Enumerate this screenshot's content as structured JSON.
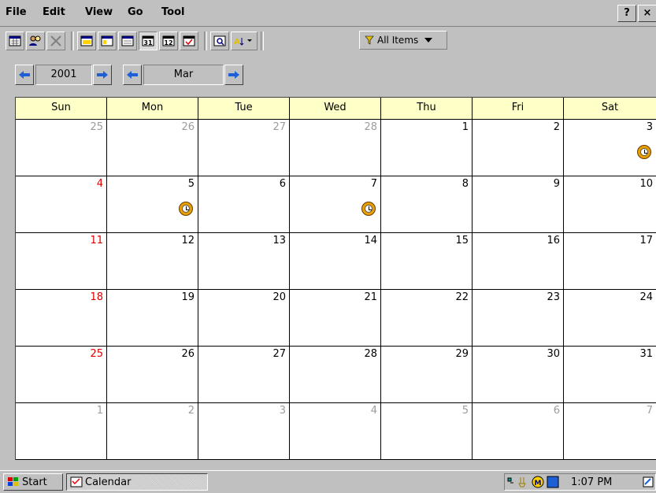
{
  "menu": [
    "File",
    "Edit",
    "View",
    "Go",
    "Tool"
  ],
  "window_buttons": {
    "help": "?",
    "close": "×"
  },
  "toolbar": {
    "filter_label": "All Items"
  },
  "nav": {
    "year": "2001",
    "month": "Mar"
  },
  "days": [
    "Sun",
    "Mon",
    "Tue",
    "Wed",
    "Thu",
    "Fri",
    "Sat"
  ],
  "weeks": [
    [
      {
        "n": "25",
        "t": "other"
      },
      {
        "n": "26",
        "t": "other"
      },
      {
        "n": "27",
        "t": "other"
      },
      {
        "n": "28",
        "t": "other"
      },
      {
        "n": "1",
        "t": "cur"
      },
      {
        "n": "2",
        "t": "cur"
      },
      {
        "n": "3",
        "t": "cur",
        "appt": true
      }
    ],
    [
      {
        "n": "4",
        "t": "sun"
      },
      {
        "n": "5",
        "t": "cur",
        "appt": true
      },
      {
        "n": "6",
        "t": "cur"
      },
      {
        "n": "7",
        "t": "cur",
        "appt": true
      },
      {
        "n": "8",
        "t": "cur"
      },
      {
        "n": "9",
        "t": "cur"
      },
      {
        "n": "10",
        "t": "cur"
      }
    ],
    [
      {
        "n": "11",
        "t": "sun"
      },
      {
        "n": "12",
        "t": "cur"
      },
      {
        "n": "13",
        "t": "cur"
      },
      {
        "n": "14",
        "t": "cur"
      },
      {
        "n": "15",
        "t": "cur"
      },
      {
        "n": "16",
        "t": "cur"
      },
      {
        "n": "17",
        "t": "cur"
      }
    ],
    [
      {
        "n": "18",
        "t": "sun"
      },
      {
        "n": "19",
        "t": "cur"
      },
      {
        "n": "20",
        "t": "cur"
      },
      {
        "n": "21",
        "t": "cur"
      },
      {
        "n": "22",
        "t": "cur"
      },
      {
        "n": "23",
        "t": "cur"
      },
      {
        "n": "24",
        "t": "cur"
      }
    ],
    [
      {
        "n": "25",
        "t": "sun"
      },
      {
        "n": "26",
        "t": "cur"
      },
      {
        "n": "27",
        "t": "cur"
      },
      {
        "n": "28",
        "t": "cur"
      },
      {
        "n": "29",
        "t": "cur"
      },
      {
        "n": "30",
        "t": "cur"
      },
      {
        "n": "31",
        "t": "cur"
      }
    ],
    [
      {
        "n": "1",
        "t": "other"
      },
      {
        "n": "2",
        "t": "other"
      },
      {
        "n": "3",
        "t": "other"
      },
      {
        "n": "4",
        "t": "other"
      },
      {
        "n": "5",
        "t": "other"
      },
      {
        "n": "6",
        "t": "other"
      },
      {
        "n": "7",
        "t": "other"
      }
    ]
  ],
  "taskbar": {
    "start": "Start",
    "task": "Calendar",
    "time": "1:07 PM"
  },
  "colors": {
    "header_bg": "#ffffc8",
    "sunday": "#e00000",
    "other_month": "#9c9c9c",
    "nav_arrow": "#1f5fd6"
  }
}
